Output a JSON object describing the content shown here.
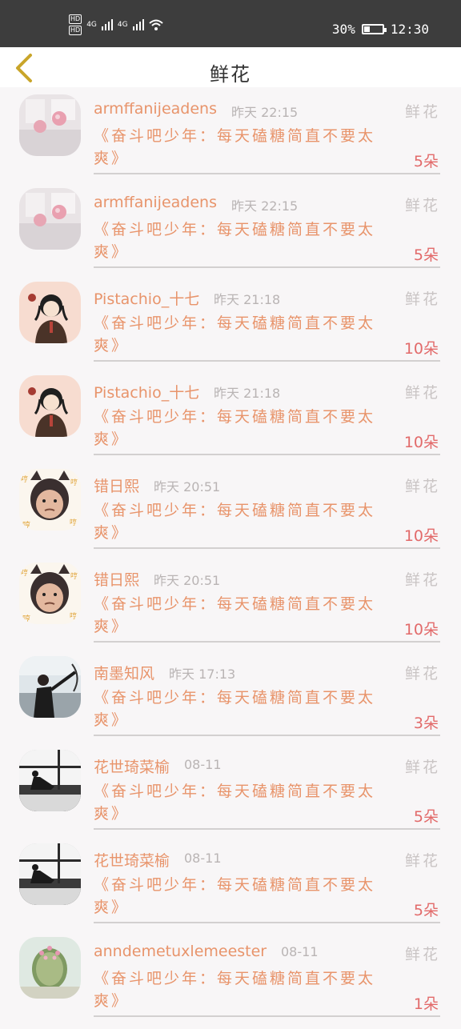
{
  "status_bar": {
    "sim1": "HD",
    "sim2": "HD",
    "net1": "4G",
    "net2": "4G",
    "battery_text": "30%",
    "battery_level": 0.3,
    "time": "12:30"
  },
  "header": {
    "title": "鲜花"
  },
  "items": [
    {
      "name": "armffanijeadens",
      "time": "昨天 22:15",
      "tag": "鲜花",
      "text": "《奋斗吧少年：每天磕糖简直不要太爽》",
      "count": "5朵",
      "avatar": "pink-avatar"
    },
    {
      "name": "armffanijeadens",
      "time": "昨天 22:15",
      "tag": "鲜花",
      "text": "《奋斗吧少年：每天磕糖简直不要太爽》",
      "count": "5朵",
      "avatar": "pink-avatar"
    },
    {
      "name": "Pistachio_十七",
      "time": "昨天 21:18",
      "tag": "鲜花",
      "text": "《奋斗吧少年：每天磕糖简直不要太爽》",
      "count": "10朵",
      "avatar": "girl-avatar"
    },
    {
      "name": "Pistachio_十七",
      "time": "昨天 21:18",
      "tag": "鲜花",
      "text": "《奋斗吧少年：每天磕糖简直不要太爽》",
      "count": "10朵",
      "avatar": "girl-avatar"
    },
    {
      "name": "错日熙",
      "time": "昨天 20:51",
      "tag": "鲜花",
      "text": "《奋斗吧少年：每天磕糖简直不要太爽》",
      "count": "10朵",
      "avatar": "baby-avatar"
    },
    {
      "name": "错日熙",
      "time": "昨天 20:51",
      "tag": "鲜花",
      "text": "《奋斗吧少年：每天磕糖简直不要太爽》",
      "count": "10朵",
      "avatar": "baby-avatar"
    },
    {
      "name": "南墨知风",
      "time": "昨天 17:13",
      "tag": "鲜花",
      "text": "《奋斗吧少年：每天磕糖简直不要太爽》",
      "count": "3朵",
      "avatar": "archer-avatar"
    },
    {
      "name": "花世琦菜榆",
      "time": "08-11",
      "tag": "鲜花",
      "text": "《奋斗吧少年：每天磕糖简直不要太爽》",
      "count": "5朵",
      "avatar": "window-avatar"
    },
    {
      "name": "花世琦菜榆",
      "time": "08-11",
      "tag": "鲜花",
      "text": "《奋斗吧少年：每天磕糖简直不要太爽》",
      "count": "5朵",
      "avatar": "window-avatar"
    },
    {
      "name": "anndemetuxlemeester",
      "time": "08-11",
      "tag": "鲜花",
      "text": "《奋斗吧少年：每天磕糖简直不要太爽》",
      "count": "1朵",
      "avatar": "cactus-avatar"
    }
  ]
}
